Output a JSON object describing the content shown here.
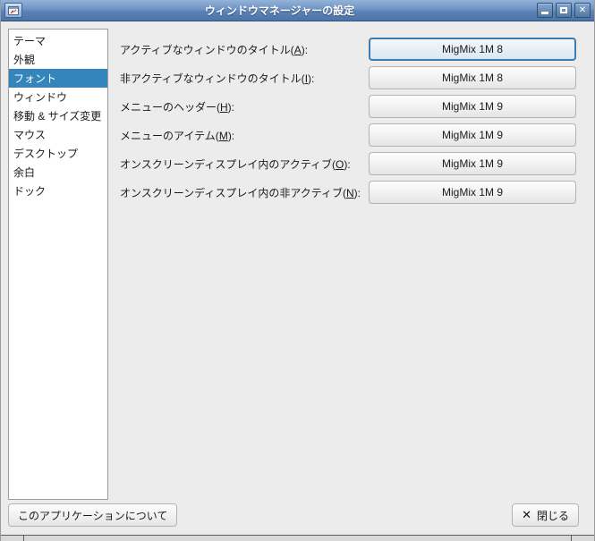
{
  "window": {
    "title": "ウィンドウマネージャーの設定",
    "close_icon_glyph": "✕"
  },
  "sidebar": {
    "selected": "フォント",
    "items": [
      {
        "label": "テーマ"
      },
      {
        "label": "外観"
      },
      {
        "label": "フォント"
      },
      {
        "label": "ウィンドウ"
      },
      {
        "label": "移動 & サイズ変更"
      },
      {
        "label": "マウス"
      },
      {
        "label": "デスクトップ"
      },
      {
        "label": "余白"
      },
      {
        "label": "ドック"
      }
    ]
  },
  "font_rows": [
    {
      "label_pre": "アクティブなウィンドウのタイトル(",
      "mnemonic": "A",
      "label_post": "):",
      "font": "MigMix 1M 8"
    },
    {
      "label_pre": "非アクティブなウィンドウのタイトル(",
      "mnemonic": "I",
      "label_post": "):",
      "font": "MigMix 1M 8"
    },
    {
      "label_pre": "メニューのヘッダー(",
      "mnemonic": "H",
      "label_post": "):",
      "font": "MigMix 1M 9"
    },
    {
      "label_pre": "メニューのアイテム(",
      "mnemonic": "M",
      "label_post": "):",
      "font": "MigMix 1M 9"
    },
    {
      "label_pre": "オンスクリーンディスプレイ内のアクティブ(",
      "mnemonic": "O",
      "label_post": "):",
      "font": "MigMix 1M 9"
    },
    {
      "label_pre": "オンスクリーンディスプレイ内の非アクティブ(",
      "mnemonic": "N",
      "label_post": "):",
      "font": "MigMix 1M 9"
    }
  ],
  "footer": {
    "about_label": "このアプリケーションについて",
    "close_icon": "✕",
    "close_label": "閉じる"
  },
  "colors": {
    "selection_blue": "#3585bd",
    "focus_blue": "#3c7cb0",
    "titlebar_top": "#93b2d9",
    "titlebar_bottom": "#4c74a7",
    "content_bg": "#ececec"
  }
}
